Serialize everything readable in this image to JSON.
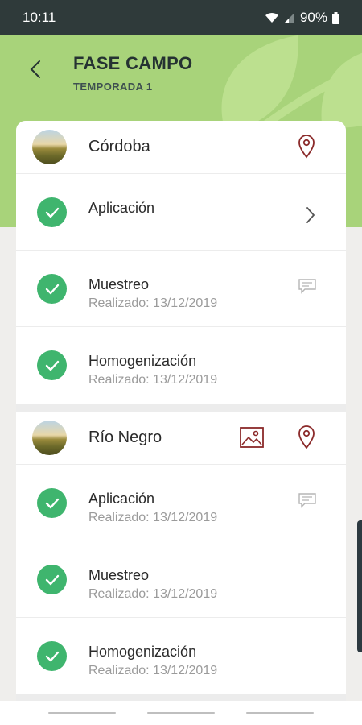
{
  "status": {
    "time": "10:11",
    "battery": "90%"
  },
  "header": {
    "title": "FASE CAMPO",
    "subtitle": "TEMPORADA 1"
  },
  "groups": [
    {
      "name": "Córdoba",
      "items": [
        {
          "title": "Aplicación",
          "subtitle": ""
        },
        {
          "title": "Muestreo",
          "subtitle": "Realizado: 13/12/2019"
        },
        {
          "title": "Homogenización",
          "subtitle": "Realizado: 13/12/2019"
        }
      ]
    },
    {
      "name": "Río Negro",
      "items": [
        {
          "title": "Aplicación",
          "subtitle": "Realizado: 13/12/2019"
        },
        {
          "title": "Muestreo",
          "subtitle": "Realizado: 13/12/2019"
        },
        {
          "title": "Homogenización",
          "subtitle": "Realizado: 13/12/2019"
        }
      ]
    }
  ],
  "colors": {
    "header_bg": "#a8d37a",
    "status_bg": "#2f3a3a",
    "check_green": "#3fb56e",
    "icon_red": "#8b2a2a"
  },
  "icons": [
    "wifi-icon",
    "signal-icon",
    "battery-icon",
    "back-arrow-icon",
    "leaf-icon",
    "location-pin-icon",
    "image-icon",
    "comment-icon",
    "chevron-right-icon",
    "check-icon"
  ]
}
